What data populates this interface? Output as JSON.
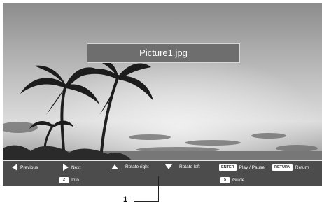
{
  "photo": {
    "title": "Picture1.jpg"
  },
  "controls": {
    "previous": "Previous",
    "next": "Next",
    "rotate_right": "Rotate right",
    "rotate_left": "Rotate left",
    "enter_key": "ENTER",
    "play_pause": "Play / Pause",
    "return_key": "RETURN",
    "return": "Return",
    "info_key": "2",
    "info": "Info",
    "guide_key": "5",
    "guide": "Guide"
  },
  "callout": {
    "label": "1"
  }
}
